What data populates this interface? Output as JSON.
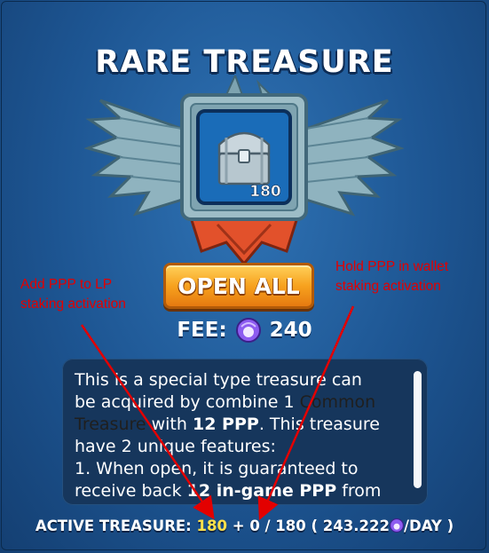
{
  "title": "RARE TREASURE",
  "emblem": {
    "icon": "treasure-chest-icon",
    "count": "180"
  },
  "open_button": {
    "label": "OPEN ALL"
  },
  "fee": {
    "label": "FEE:",
    "icon": "pearl-gem-icon",
    "value": "240"
  },
  "description": {
    "line1": "This is a special type treasure can",
    "line2a": "be acquired by combine 1 ",
    "line2b": "Common",
    "line3a": "Treasure",
    "line3b": " with ",
    "line3c": "12 PPP",
    "line3d": ". This treasure",
    "line4": "have 2 unique features:",
    "line5": "1. When open, it is guaranteed to",
    "line6a": "receive back ",
    "line6b": "12 in-game PPP",
    "line6c": " from"
  },
  "active_treasure": {
    "label": "ACTIVE TREASURE:",
    "lp_value": "180",
    "plus": "+",
    "wallet_value": "0 / 180",
    "rate_open": "( 243.222",
    "rate_close": "/DAY )",
    "icon": "pearl-gem-icon"
  },
  "annotations": {
    "left_line1": "Add PPP to LP",
    "left_line2": "staking activation",
    "right_line1": "Hold PPP in wallet",
    "right_line2": "staking activation",
    "color": "#e30000"
  },
  "colors": {
    "accent_yellow": "#ffe04a",
    "button_orange": "#f7a21e",
    "panel": "#16365c",
    "background": "#1d5592"
  }
}
